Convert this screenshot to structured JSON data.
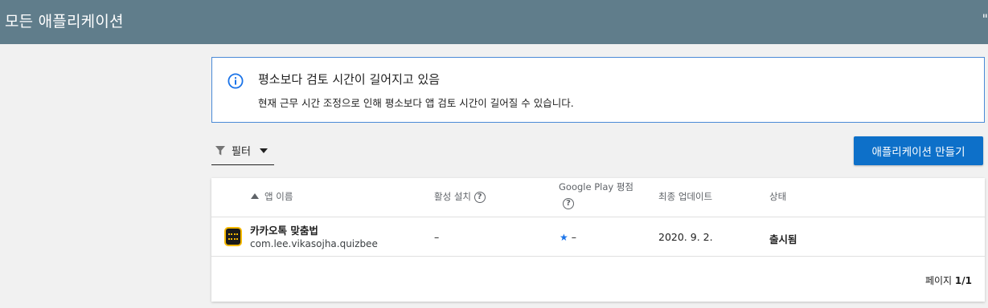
{
  "header": {
    "title": "모든 애플리케이션",
    "edge_glyph": "\""
  },
  "notice": {
    "title": "평소보다 검토 시간이 길어지고 있음",
    "body": "현재 근무 시간 조정으로 인해 평소보다 앱 검토 시간이 길어질 수 있습니다.",
    "icon": "info-icon",
    "accent": "#1a73e8"
  },
  "filter": {
    "label": "필터",
    "icon": "filter-icon"
  },
  "create_button": {
    "label": "애플리케이션 만들기",
    "color": "#0d70c9"
  },
  "table": {
    "columns": {
      "app_name": "앱 이름",
      "active_installs": "활성 설치",
      "rating": "Google Play 평점",
      "last_update": "최종 업데이트",
      "status": "상태"
    },
    "rows": [
      {
        "name": "카카오톡 맞춤법",
        "package": "com.lee.vikasojha.quizbee",
        "installs": "–",
        "rating_star": "★",
        "rating": "–",
        "updated": "2020. 9. 2.",
        "status": "출시됨"
      }
    ]
  },
  "pagination": {
    "label": "페이지",
    "value": "1/1"
  }
}
